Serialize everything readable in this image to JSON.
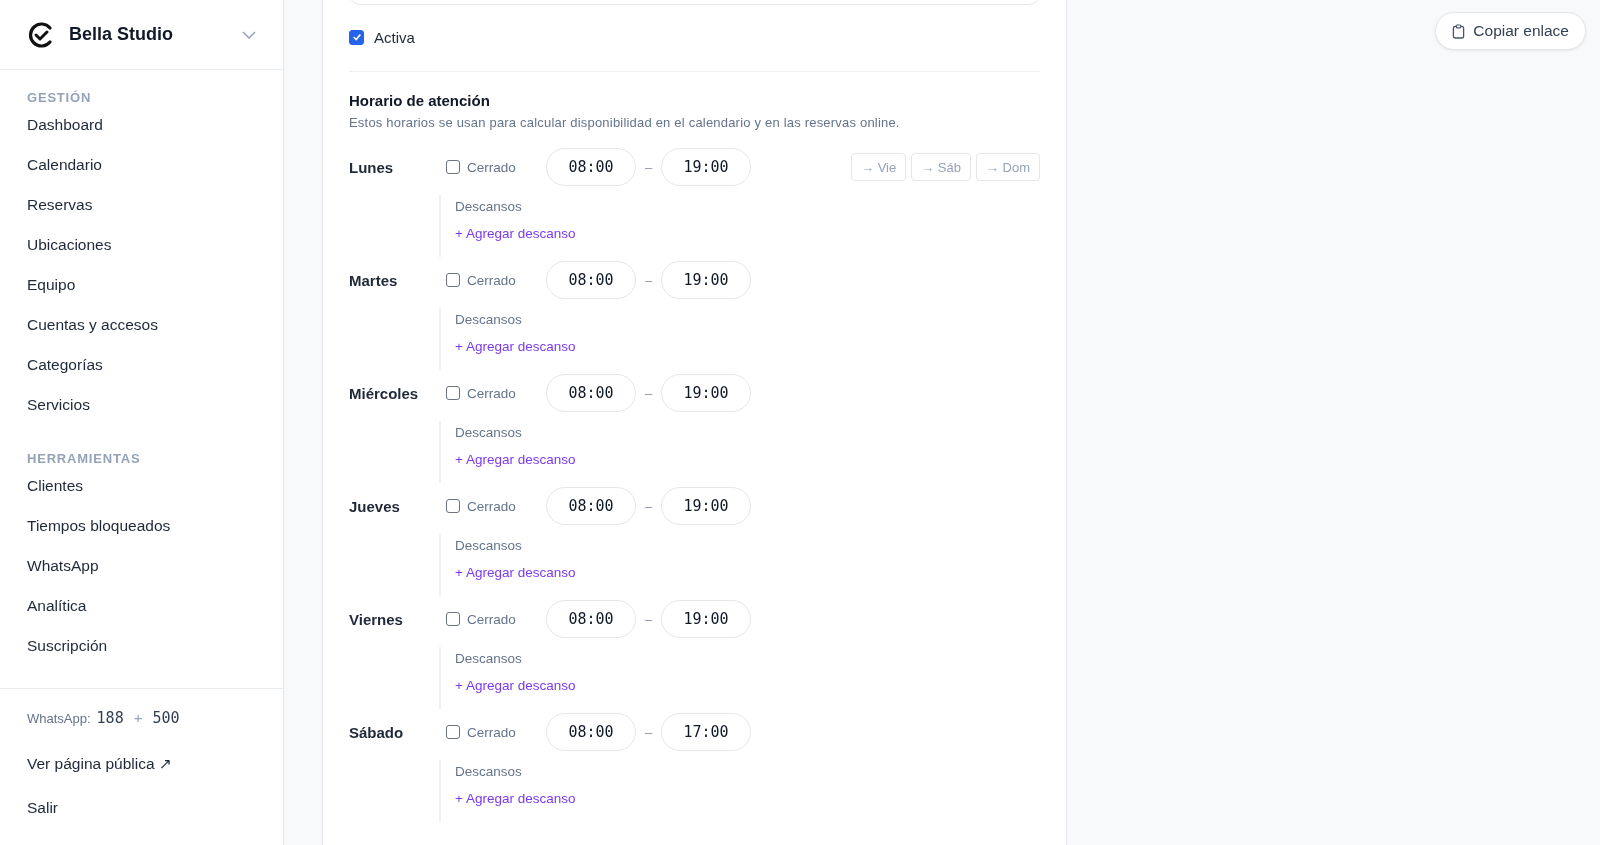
{
  "sidebar": {
    "brand": "Bella Studio",
    "groups": [
      {
        "title": "GESTIÓN",
        "items": [
          "Dashboard",
          "Calendario",
          "Reservas",
          "Ubicaciones",
          "Equipo",
          "Cuentas y accesos",
          "Categorías",
          "Servicios"
        ]
      },
      {
        "title": "HERRAMIENTAS",
        "items": [
          "Clientes",
          "Tiempos bloqueados",
          "WhatsApp",
          "Analítica",
          "Suscripción"
        ]
      }
    ],
    "footer": {
      "whatsapp_label": "WhatsApp:",
      "whatsapp_used": "188",
      "whatsapp_plus": "+",
      "whatsapp_extra": "500",
      "public_link": "Ver página pública ↗",
      "logout": "Salir"
    }
  },
  "form": {
    "active": {
      "label": "Activa",
      "checked": true
    },
    "schedule": {
      "title": "Horario de atención",
      "description": "Estos horarios se usan para calcular disponibilidad en el calendario y en las reservas online.",
      "days": [
        {
          "name": "Lunes",
          "closed_label": "Cerrado",
          "closed": false,
          "open": "08:00",
          "separator": "–",
          "close": "19:00",
          "breaks_label": "Descansos",
          "add_break": "+ Agregar descanso",
          "copy_to": [
            "→ Vie",
            "→ Sáb",
            "→ Dom"
          ]
        },
        {
          "name": "Martes",
          "closed_label": "Cerrado",
          "closed": false,
          "open": "08:00",
          "separator": "–",
          "close": "19:00",
          "breaks_label": "Descansos",
          "add_break": "+ Agregar descanso"
        },
        {
          "name": "Miércoles",
          "closed_label": "Cerrado",
          "closed": false,
          "open": "08:00",
          "separator": "–",
          "close": "19:00",
          "breaks_label": "Descansos",
          "add_break": "+ Agregar descanso"
        },
        {
          "name": "Jueves",
          "closed_label": "Cerrado",
          "closed": false,
          "open": "08:00",
          "separator": "–",
          "close": "19:00",
          "breaks_label": "Descansos",
          "add_break": "+ Agregar descanso"
        },
        {
          "name": "Viernes",
          "closed_label": "Cerrado",
          "closed": false,
          "open": "08:00",
          "separator": "–",
          "close": "19:00",
          "breaks_label": "Descansos",
          "add_break": "+ Agregar descanso"
        },
        {
          "name": "Sábado",
          "closed_label": "Cerrado",
          "closed": false,
          "open": "08:00",
          "separator": "–",
          "close": "17:00",
          "breaks_label": "Descansos",
          "add_break": "+ Agregar descanso"
        }
      ]
    }
  },
  "copy_link": "Copiar enlace"
}
